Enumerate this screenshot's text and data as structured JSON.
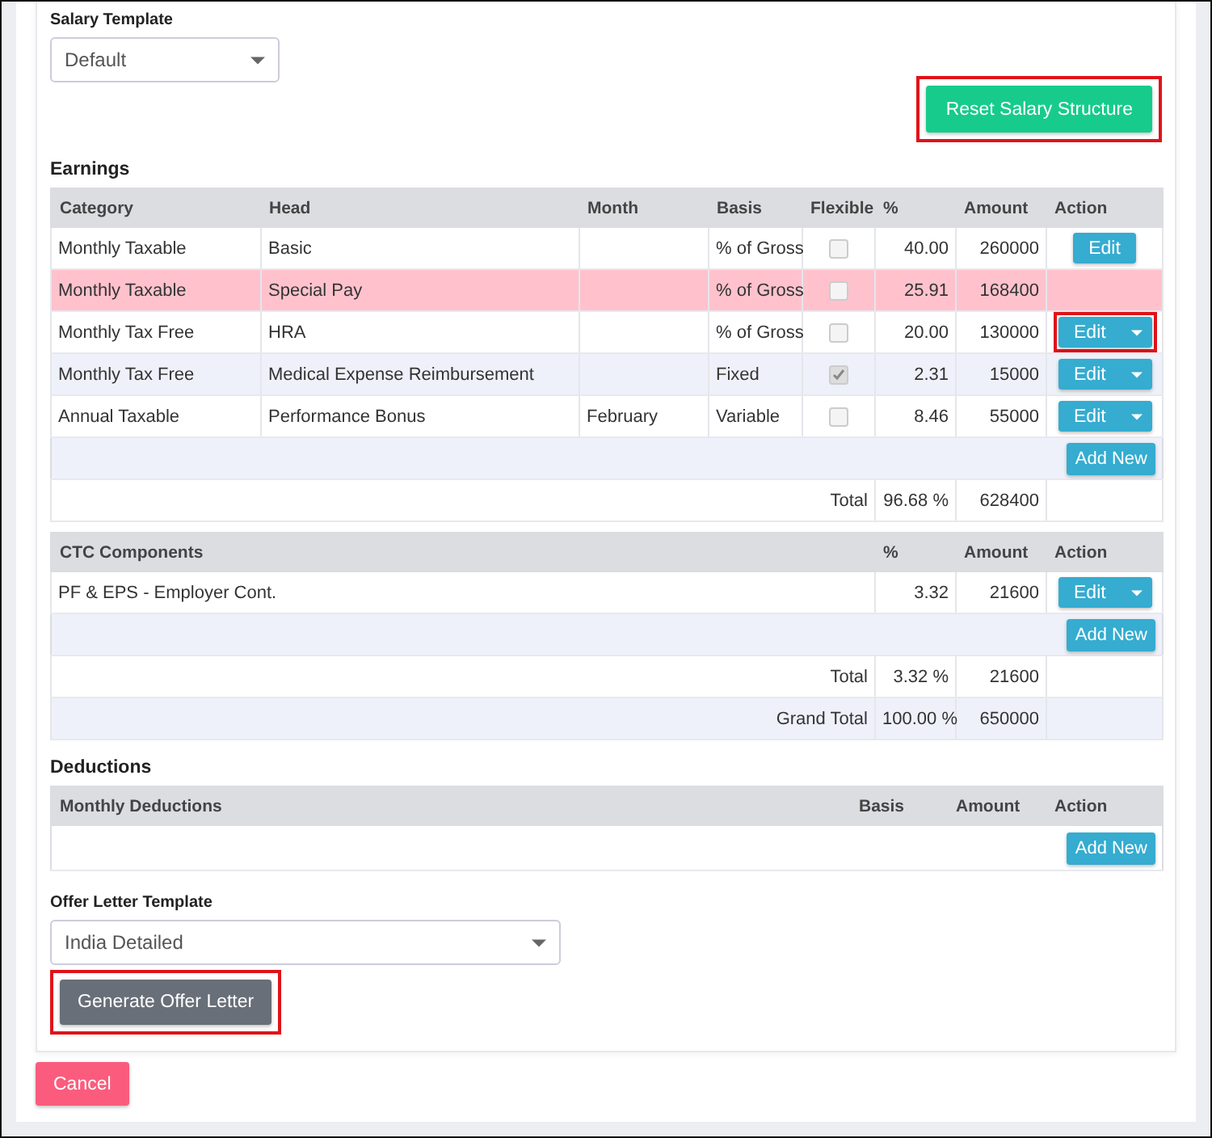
{
  "salary_template": {
    "label": "Salary Template",
    "value": "Default"
  },
  "reset_button": {
    "label": "Reset Salary Structure",
    "highlighted": true
  },
  "earnings": {
    "title": "Earnings",
    "columns": [
      "Category",
      "Head",
      "Month",
      "Basis",
      "Flexible",
      "%",
      "Amount",
      "Action"
    ],
    "rows": [
      {
        "category": "Monthly Taxable",
        "head": "Basic",
        "basis": "% of Gross",
        "flexible": false,
        "percent": "40.00",
        "amount": "260000",
        "highlighted": false,
        "action": {
          "kind": "plain",
          "label": "Edit",
          "highlighted": false
        }
      },
      {
        "category": "Monthly Taxable",
        "head": "Special Pay",
        "basis": "% of Gross",
        "flexible": false,
        "percent": "25.91",
        "amount": "168400",
        "highlighted": true
      },
      {
        "category": "Monthly Tax Free",
        "head": "HRA",
        "basis": "% of Gross",
        "flexible": false,
        "percent": "20.00",
        "amount": "130000",
        "highlighted": false,
        "action": {
          "kind": "split",
          "label": "Edit",
          "highlighted": true
        }
      },
      {
        "category": "Monthly Tax Free",
        "head": "Medical Expense Reimbursement",
        "basis": "Fixed",
        "flexible": true,
        "percent": "2.31",
        "amount": "15000",
        "highlighted": false,
        "action": {
          "kind": "split",
          "label": "Edit",
          "highlighted": false
        }
      },
      {
        "category": "Annual Taxable",
        "head": "Performance Bonus",
        "month": "February",
        "basis": "Variable",
        "flexible": false,
        "percent": "8.46",
        "amount": "55000",
        "highlighted": false,
        "action": {
          "kind": "split",
          "label": "Edit",
          "highlighted": false
        }
      }
    ],
    "add_button": "Add New",
    "total": {
      "label": "Total",
      "percent": "96.68 %",
      "amount": "628400"
    }
  },
  "ctc": {
    "columns": [
      "CTC Components",
      "%",
      "Amount",
      "Action"
    ],
    "rows": [
      {
        "name": "PF & EPS - Employer Cont.",
        "percent": "3.32",
        "amount": "21600",
        "action": {
          "kind": "split",
          "label": "Edit",
          "highlighted": false
        }
      }
    ],
    "add_button": "Add New",
    "total": {
      "label": "Total",
      "percent": "3.32 %",
      "amount": "21600"
    },
    "grand_total": {
      "label": "Grand Total",
      "percent": "100.00 %",
      "amount": "650000"
    }
  },
  "deductions": {
    "title": "Deductions",
    "columns": [
      "Monthly Deductions",
      "Basis",
      "Amount",
      "Action"
    ],
    "add_button": "Add New"
  },
  "offer_letter_template": {
    "label": "Offer Letter Template",
    "value": "India Detailed"
  },
  "generate_button": {
    "label": "Generate Offer Letter",
    "highlighted": true
  },
  "cancel_button": {
    "label": "Cancel"
  }
}
